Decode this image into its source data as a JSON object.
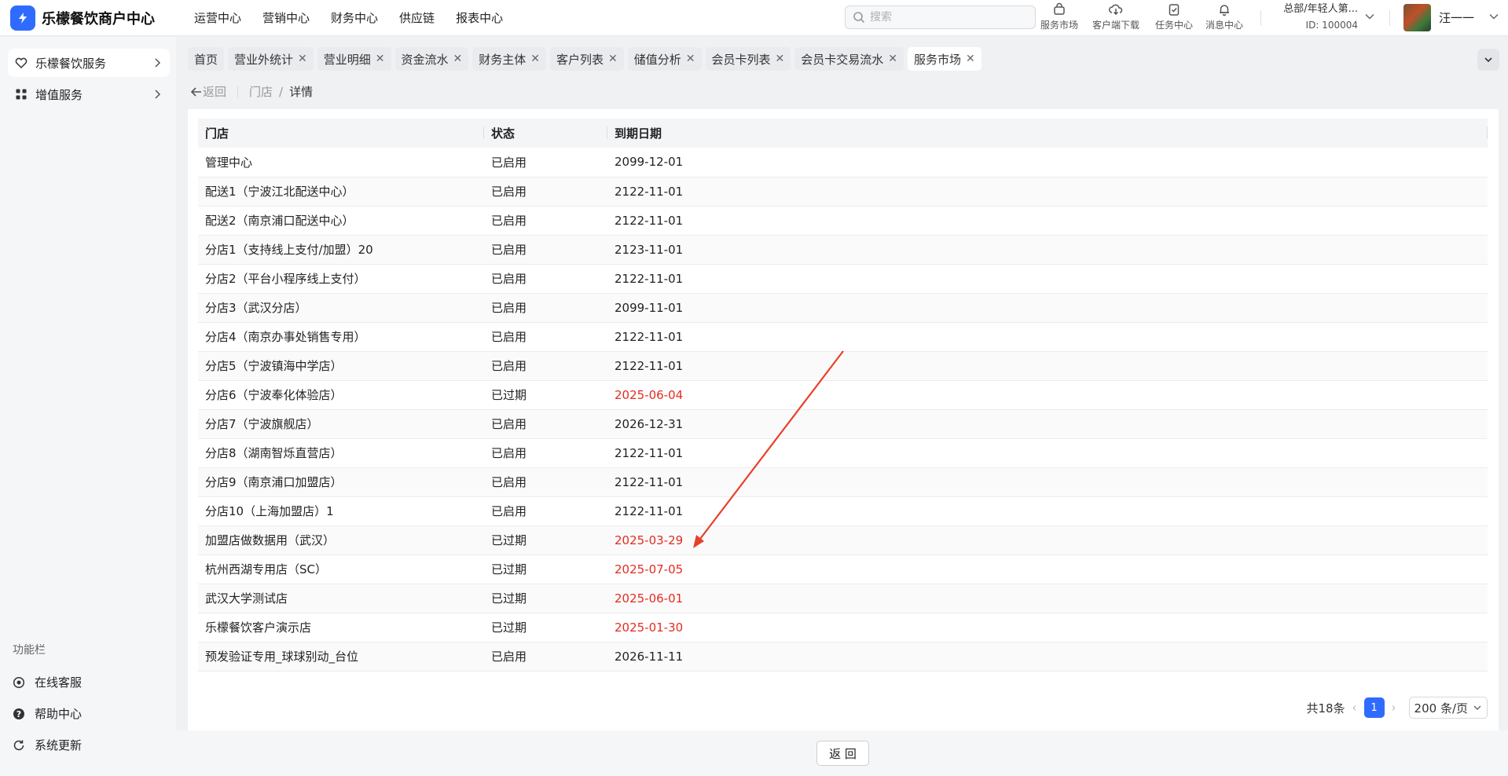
{
  "app": {
    "name": "乐檬餐饮商户中心"
  },
  "top_nav": [
    "运营中心",
    "营销中心",
    "财务中心",
    "供应链",
    "报表中心"
  ],
  "search": {
    "placeholder": "搜索"
  },
  "tools": [
    {
      "label": "服务市场",
      "icon": "shop-bag-icon"
    },
    {
      "label": "客户端下载",
      "icon": "cloud-download-icon"
    },
    {
      "label": "任务中心",
      "icon": "clipboard-check-icon"
    },
    {
      "label": "消息中心",
      "icon": "bell-icon"
    }
  ],
  "org": {
    "name": "总部/年轻人第...",
    "id": "ID: 100004"
  },
  "user": {
    "name": "汪一一"
  },
  "sidebar": {
    "items": [
      {
        "label": "乐檬餐饮服务",
        "icon": "heart-badge-icon"
      },
      {
        "label": "增值服务",
        "icon": "grid-apps-icon"
      }
    ],
    "section_title": "功能栏",
    "footer_items": [
      {
        "label": "在线客服",
        "icon": "headset-icon"
      },
      {
        "label": "帮助中心",
        "icon": "question-circle-icon"
      },
      {
        "label": "系统更新",
        "icon": "refresh-icon"
      }
    ]
  },
  "tabs": [
    "首页",
    "营业外统计",
    "营业明细",
    "资金流水",
    "财务主体",
    "客户列表",
    "储值分析",
    "会员卡列表",
    "会员卡交易流水",
    "服务市场"
  ],
  "breadcrumb": {
    "back": "返回",
    "parent": "门店",
    "current": "详情"
  },
  "table": {
    "columns": [
      "门店",
      "状态",
      "到期日期"
    ],
    "rows": [
      {
        "store": "管理中心",
        "status": "已启用",
        "date": "2099-12-01"
      },
      {
        "store": "配送1（宁波江北配送中心）",
        "status": "已启用",
        "date": "2122-11-01"
      },
      {
        "store": "配送2（南京浦口配送中心）",
        "status": "已启用",
        "date": "2122-11-01"
      },
      {
        "store": "分店1（支持线上支付/加盟）20",
        "status": "已启用",
        "date": "2123-11-01"
      },
      {
        "store": "分店2（平台小程序线上支付）",
        "status": "已启用",
        "date": "2122-11-01"
      },
      {
        "store": "分店3（武汉分店）",
        "status": "已启用",
        "date": "2099-11-01"
      },
      {
        "store": "分店4（南京办事处销售专用）",
        "status": "已启用",
        "date": "2122-11-01"
      },
      {
        "store": "分店5（宁波镇海中学店）",
        "status": "已启用",
        "date": "2122-11-01"
      },
      {
        "store": "分店6（宁波奉化体验店）",
        "status": "已过期",
        "date": "2025-06-04"
      },
      {
        "store": "分店7（宁波旗舰店）",
        "status": "已启用",
        "date": "2026-12-31"
      },
      {
        "store": "分店8（湖南智烁直营店）",
        "status": "已启用",
        "date": "2122-11-01"
      },
      {
        "store": "分店9（南京浦口加盟店）",
        "status": "已启用",
        "date": "2122-11-01"
      },
      {
        "store": "分店10（上海加盟店）1",
        "status": "已启用",
        "date": "2122-11-01"
      },
      {
        "store": "加盟店做数据用（武汉）",
        "status": "已过期",
        "date": "2025-03-29"
      },
      {
        "store": "杭州西湖专用店（SC）",
        "status": "已过期",
        "date": "2025-07-05"
      },
      {
        "store": "武汉大学测试店",
        "status": "已过期",
        "date": "2025-06-01"
      },
      {
        "store": "乐檬餐饮客户演示店",
        "status": "已过期",
        "date": "2025-01-30"
      },
      {
        "store": "预发验证专用_球球别动_台位",
        "status": "已启用",
        "date": "2026-11-11"
      }
    ]
  },
  "pagination": {
    "total": "共18条",
    "current_page": "1",
    "page_size": "200 条/页"
  },
  "footer": {
    "return_button": "返 回"
  },
  "colors": {
    "accent": "#2f6bff",
    "expired": "#e52b20",
    "annotation_arrow": "#e8402a"
  }
}
